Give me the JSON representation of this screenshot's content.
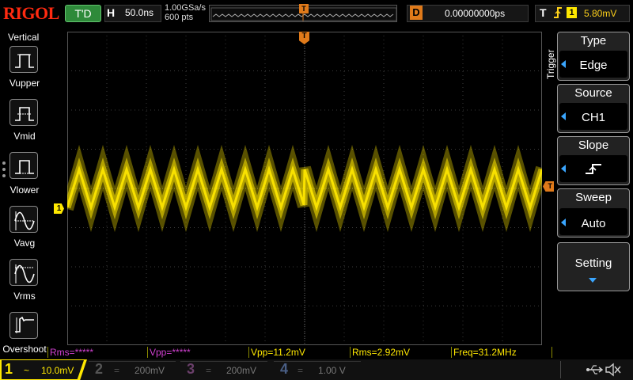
{
  "brand": "RIGOL",
  "top_bar": {
    "run_status": "T'D",
    "horizontal": {
      "letter": "H",
      "timebase": "50.0ns"
    },
    "sample_rate": "1.00GSa/s",
    "memory_depth": "600 pts",
    "trigger_marker": "T",
    "delay": {
      "letter": "D",
      "value": "0.00000000ps"
    },
    "trigger": {
      "letter": "T",
      "edge_icon": "rising-edge-icon",
      "channel": "1",
      "level": "5.80mV"
    }
  },
  "left_menu": {
    "title": "Vertical",
    "items": [
      {
        "label": "Vupper",
        "icon": "vupper-icon"
      },
      {
        "label": "Vmid",
        "icon": "vmid-icon"
      },
      {
        "label": "Vlower",
        "icon": "vlower-icon"
      },
      {
        "label": "Vavg",
        "icon": "vavg-icon"
      },
      {
        "label": "Vrms",
        "icon": "vrms-icon"
      },
      {
        "label": "Overshoot",
        "icon": "overshoot-icon"
      }
    ]
  },
  "right_menu": {
    "title": "Trigger",
    "items": [
      {
        "title": "Type",
        "value": "Edge"
      },
      {
        "title": "Source",
        "value": "CH1"
      },
      {
        "title": "Slope",
        "value": "rising-slope-icon"
      },
      {
        "title": "Sweep",
        "value": "Auto"
      },
      {
        "title": "Setting",
        "value": "down-arrow-icon"
      }
    ]
  },
  "markers": {
    "ch1_ground": "1",
    "trigger_position": "T",
    "trigger_level": "T"
  },
  "measurements": [
    {
      "text": "Rms=*****",
      "color": "#d040d0"
    },
    {
      "text": "Vpp=*****",
      "color": "#d040d0"
    },
    {
      "text": "Vpp=11.2mV",
      "color": "#ffe800"
    },
    {
      "text": "Rms=2.92mV",
      "color": "#ffe800"
    },
    {
      "text": "Freq=31.2MHz",
      "color": "#ffe800"
    }
  ],
  "channels": [
    {
      "num": "1",
      "coupling": "~",
      "scale": "10.0mV",
      "color": "#ffe800",
      "active": true
    },
    {
      "num": "2",
      "coupling": "=",
      "scale": "200mV",
      "color": "#2f9ad0",
      "active": false
    },
    {
      "num": "3",
      "coupling": "=",
      "scale": "200mV",
      "color": "#c040c0",
      "active": false
    },
    {
      "num": "4",
      "coupling": "=",
      "scale": "1.00 V",
      "color": "#3a7fd0",
      "active": false
    }
  ],
  "status_icons": [
    "usb-icon",
    "speaker-mute-icon"
  ],
  "colors": {
    "ch1": "#ffe800",
    "trigger": "#e07a1a",
    "accent": "#3aa6ff",
    "brand": "#ff2a10"
  }
}
